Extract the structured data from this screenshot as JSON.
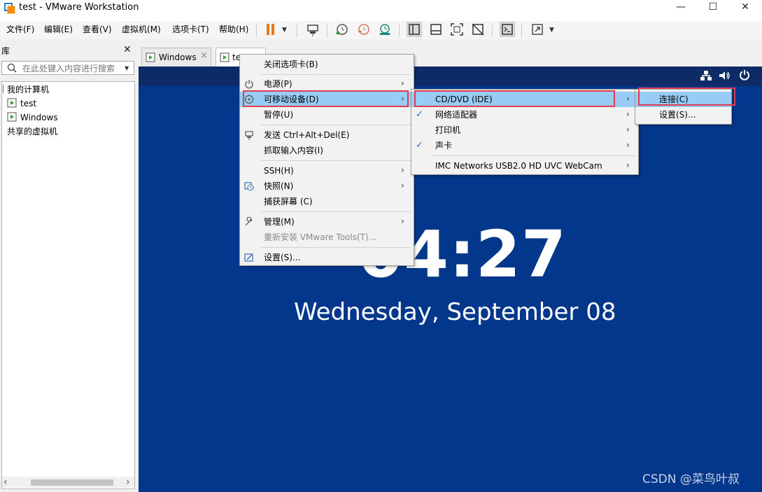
{
  "window": {
    "title": "test - VMware Workstation",
    "min_glyph": "—",
    "max_glyph": "☐",
    "close_glyph": "✕"
  },
  "menubar": {
    "items": [
      "文件(F)",
      "编辑(E)",
      "查看(V)",
      "虚拟机(M)",
      "选项卡(T)",
      "帮助(H)"
    ]
  },
  "library": {
    "title": "库",
    "close_glyph": "✕",
    "search_placeholder": "在此处键入内容进行搜索",
    "tree": {
      "root": "我的计算机",
      "vms": [
        "test",
        "Windows"
      ],
      "shared": "共享的虚拟机"
    }
  },
  "tabs": [
    {
      "label": "Windows",
      "close_glyph": "×"
    },
    {
      "label": "te",
      "close_glyph": ""
    }
  ],
  "vm_screen": {
    "clock": "04:27",
    "date": "Wednesday, September 08"
  },
  "watermark": "CSDN @菜鸟叶叔",
  "context_menu": {
    "items": [
      {
        "label": "关闭选项卡(B)"
      },
      {
        "label": "电源(P)"
      },
      {
        "label": "可移动设备(D)"
      },
      {
        "label": "暂停(U)"
      },
      {
        "label": "发送 Ctrl+Alt+Del(E)"
      },
      {
        "label": "抓取输入内容(I)"
      },
      {
        "label": "SSH(H)"
      },
      {
        "label": "快照(N)"
      },
      {
        "label": "捕获屏幕 (C)"
      },
      {
        "label": "管理(M)"
      },
      {
        "label": "重新安装 VMware Tools(T)..."
      },
      {
        "label": "设置(S)..."
      }
    ]
  },
  "removable_menu": {
    "items": [
      {
        "label": "CD/DVD (IDE)"
      },
      {
        "label": "网络适配器"
      },
      {
        "label": "打印机"
      },
      {
        "label": "声卡"
      },
      {
        "label": "IMC Networks USB2.0 HD UVC WebCam"
      }
    ]
  },
  "cd_menu": {
    "items": [
      {
        "label": "连接(C)"
      },
      {
        "label": "设置(S)..."
      }
    ]
  },
  "glyphs": {
    "arrow": "›",
    "check": "✓",
    "dropdown": "▼",
    "scroll_left": "‹",
    "scroll_right": "›"
  },
  "colors": {
    "vm_background": "#03378c",
    "menu_highlight": "#99ccf4",
    "annotation_red": "#e03b4f",
    "pause_orange": "#e9781e"
  }
}
